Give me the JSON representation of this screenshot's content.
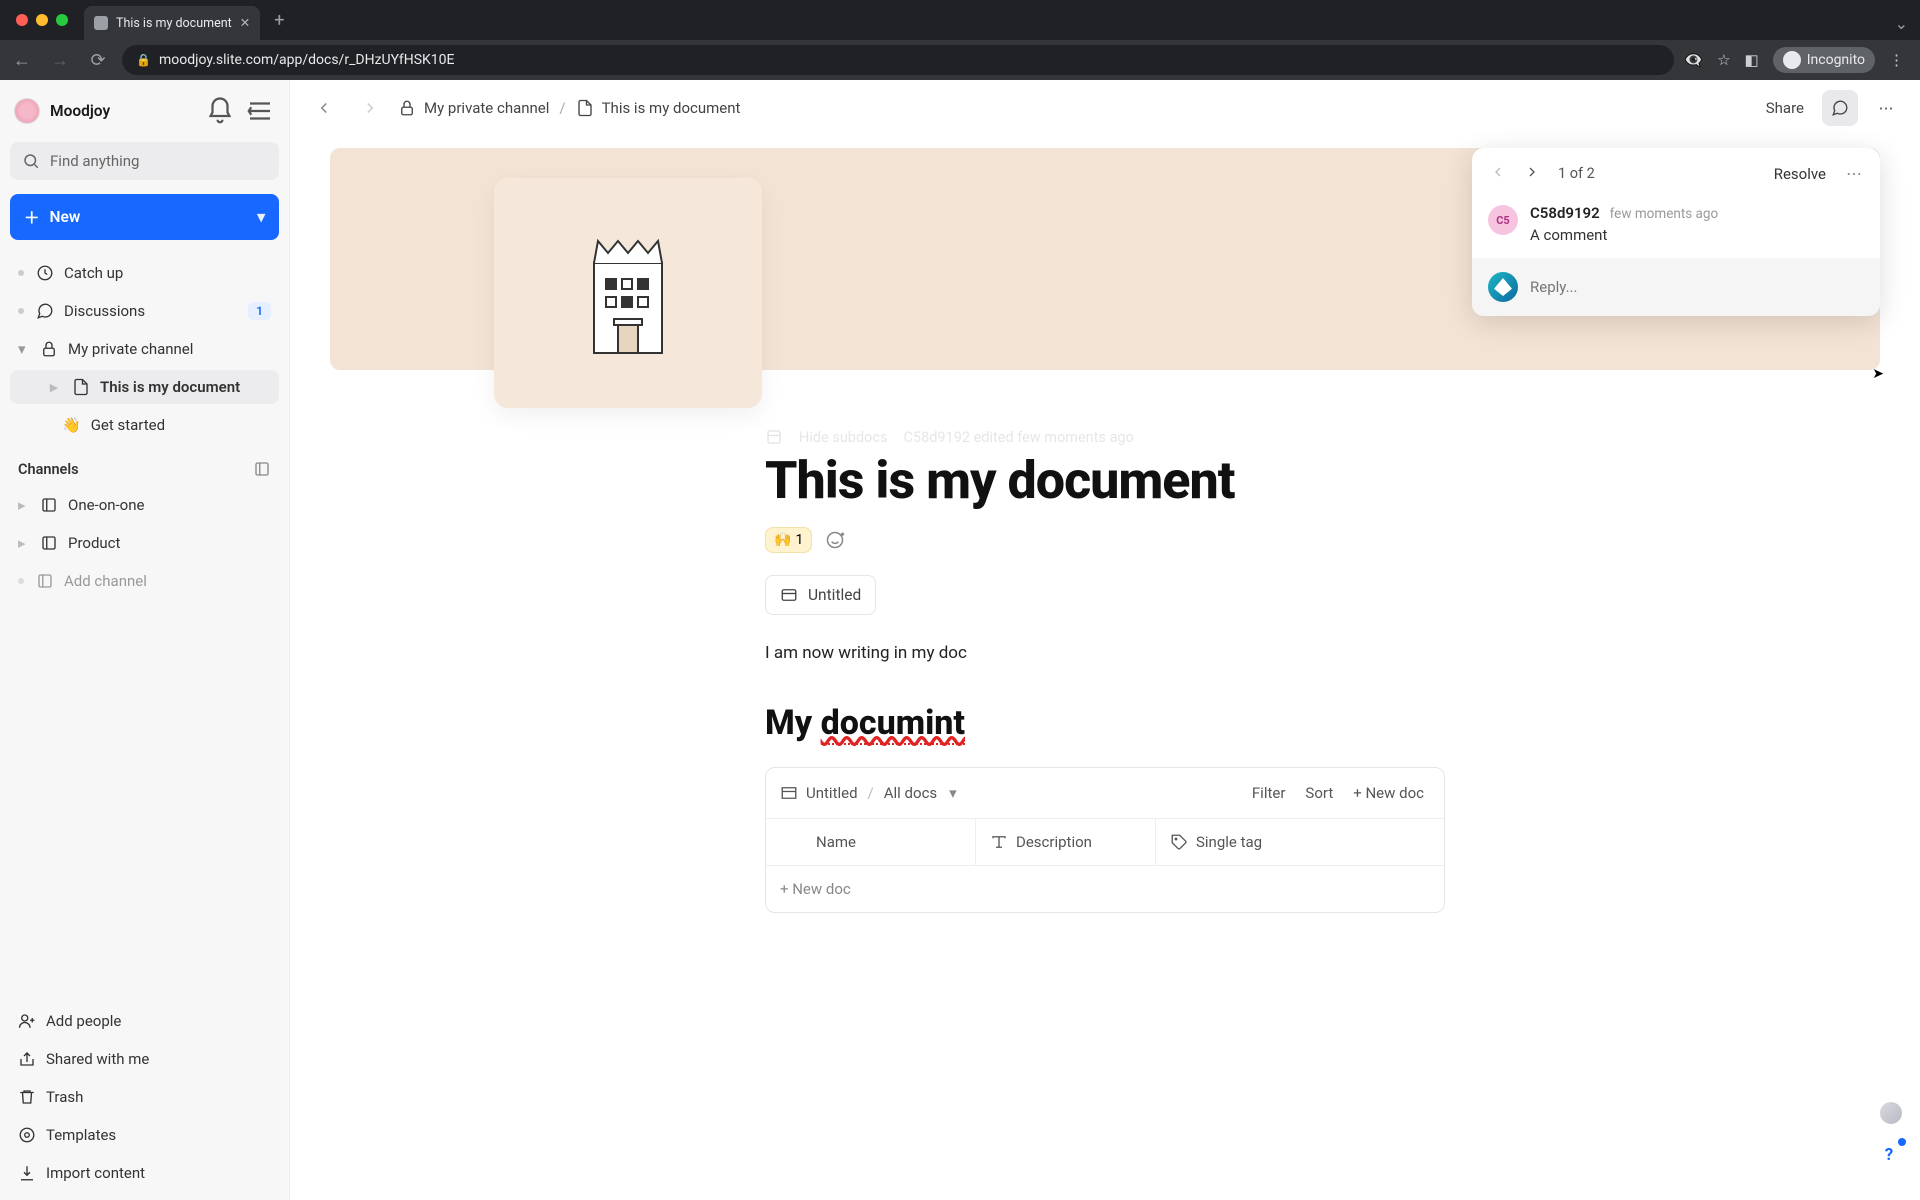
{
  "chrome": {
    "tab_title": "This is my document",
    "url": "moodjoy.slite.com/app/docs/r_DHzUYfHSK10E",
    "incognito": "Incognito"
  },
  "workspace": {
    "name": "Moodjoy"
  },
  "search": {
    "placeholder": "Find anything"
  },
  "new_button": "New",
  "sidebar": {
    "catch_up": "Catch up",
    "discussions": "Discussions",
    "discussions_badge": "1",
    "my_channel": "My private channel",
    "this_doc": "This is my document",
    "get_started": "Get started",
    "channels_header": "Channels",
    "one_on_one": "One-on-one",
    "product": "Product",
    "add_channel": "Add channel",
    "add_people": "Add people",
    "shared": "Shared with me",
    "trash": "Trash",
    "templates": "Templates",
    "import": "Import content"
  },
  "breadcrumb": {
    "channel": "My private channel",
    "doc": "This is my document"
  },
  "topbar": {
    "share": "Share"
  },
  "meta": {
    "hide_subdocs": "Hide subdocs",
    "edited": "C58d9192 edited few moments ago"
  },
  "document": {
    "title": "This is my document",
    "reaction_emoji": "🙌",
    "reaction_count": "1",
    "subdoc_untitled": "Untitled",
    "paragraph": "I am now writing in my doc",
    "heading_prefix": "My ",
    "heading_misspelled": "documint"
  },
  "database": {
    "breadcrumb_untitled": "Untitled",
    "breadcrumb_all": "All docs",
    "filter": "Filter",
    "sort": "Sort",
    "new_doc": "New doc",
    "col_name": "Name",
    "col_desc": "Description",
    "col_tag": "Single tag",
    "row_new_doc": "+ New doc"
  },
  "comments": {
    "counter": "1 of 2",
    "resolve": "Resolve",
    "author": "C58d9192",
    "avatar_initials": "C5",
    "time": "few moments ago",
    "text": "A comment",
    "reply_placeholder": "Reply..."
  }
}
